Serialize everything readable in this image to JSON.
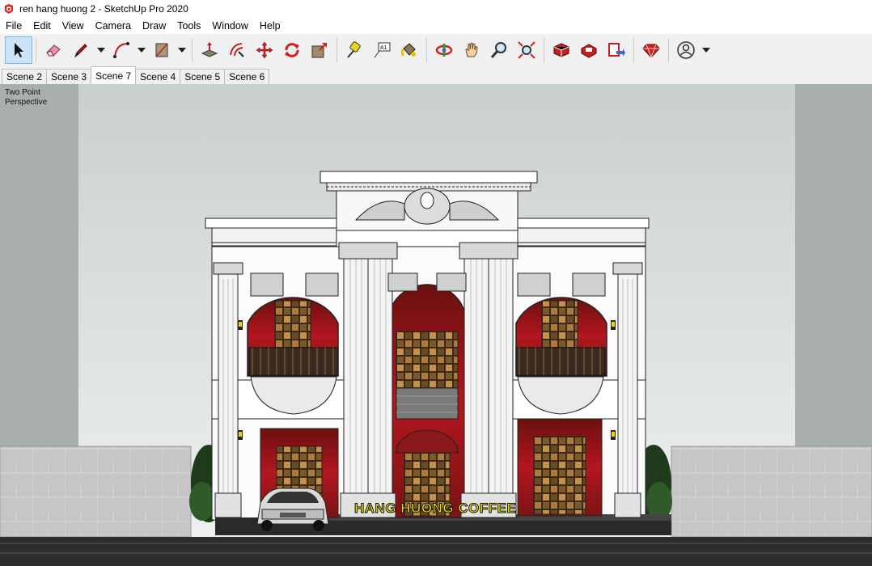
{
  "window": {
    "title": "ren hang huong 2 - SketchUp Pro 2020",
    "app_icon": "sketchup-logo-icon"
  },
  "menu": [
    "File",
    "Edit",
    "View",
    "Camera",
    "Draw",
    "Tools",
    "Window",
    "Help"
  ],
  "toolbar": {
    "tools": [
      {
        "icon": "select-arrow-icon",
        "active": true
      },
      {
        "icon": "eraser-icon"
      },
      {
        "icon": "pencil-line-icon",
        "dropdown": true
      },
      {
        "icon": "arc-icon",
        "dropdown": true
      },
      {
        "icon": "rectangle-shape-icon",
        "dropdown": true
      },
      {
        "icon": "push-pull-icon"
      },
      {
        "icon": "offset-icon"
      },
      {
        "icon": "move-icon"
      },
      {
        "icon": "rotate-icon"
      },
      {
        "icon": "scale-icon"
      },
      {
        "icon": "tape-measure-icon"
      },
      {
        "icon": "text-label-icon"
      },
      {
        "icon": "paint-bucket-icon"
      },
      {
        "icon": "orbit-icon"
      },
      {
        "icon": "pan-hand-icon"
      },
      {
        "icon": "zoom-icon"
      },
      {
        "icon": "zoom-extents-icon"
      },
      {
        "icon": "3d-warehouse-icon"
      },
      {
        "icon": "extension-warehouse-icon"
      },
      {
        "icon": "send-to-layout-icon"
      },
      {
        "icon": "ruby-console-icon"
      },
      {
        "icon": "user-account-icon",
        "dropdown": true
      }
    ]
  },
  "scenes": {
    "tabs": [
      "Scene 2",
      "Scene 3",
      "Scene 7",
      "Scene 4",
      "Scene 5",
      "Scene 6"
    ],
    "active": "Scene 7"
  },
  "viewport": {
    "camera_label": "Two Point\nPerspective",
    "sign_text": "HANG HUONG COFFEE"
  },
  "colors": {
    "sky": "#d6dada",
    "building": "#ffffff",
    "outline": "#1a1a1a",
    "window_red": "#b3161e",
    "sign_yellow": "#f5e600",
    "side_wall": "#bdbdbd",
    "road": "#2e2e2e"
  }
}
